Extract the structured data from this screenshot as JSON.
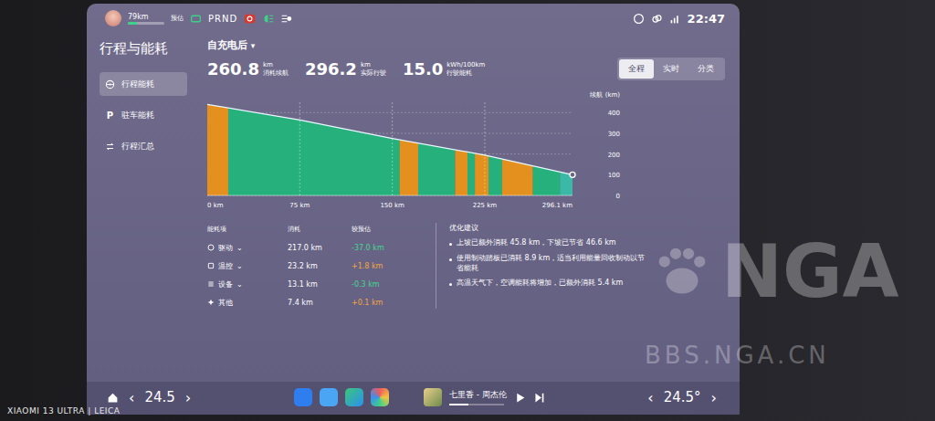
{
  "status_bar": {
    "range": "79km",
    "range_level": 0.25,
    "estimate": "预估",
    "gear": "PRND",
    "time": "22:47"
  },
  "sidebar": {
    "title": "行程与能耗",
    "items": [
      {
        "label": "行程能耗",
        "selected": true,
        "kind": "wheel"
      },
      {
        "label": "驻车能耗",
        "selected": false,
        "kind": "letter",
        "glyph": "P"
      },
      {
        "label": "行程汇总",
        "selected": false,
        "kind": "route"
      }
    ]
  },
  "filter": {
    "label": "自充电后",
    "arrow": "▾"
  },
  "stats": [
    {
      "value": "260.8",
      "unit": "km",
      "label": "消耗续航"
    },
    {
      "value": "296.2",
      "unit": "km",
      "label": "实际行驶"
    },
    {
      "value": "15.0",
      "unit": "kWh/100km",
      "label": "行驶能耗"
    }
  ],
  "modes": [
    {
      "label": "全程",
      "selected": true
    },
    {
      "label": "实时",
      "selected": false
    },
    {
      "label": "分类",
      "selected": false
    }
  ],
  "chart": {
    "y_axis_title": "续航 (km)",
    "y_ticks": [
      "400",
      "300",
      "200",
      "100",
      "0"
    ],
    "x_ticks": [
      "0 km",
      "75 km",
      "150 km",
      "225 km",
      "296.1 km"
    ],
    "series": {
      "km": [
        0,
        75,
        150,
        225,
        296.1
      ],
      "range": [
        440,
        365,
        275,
        195,
        100
      ]
    },
    "segments": [
      {
        "start": 0,
        "end": 17,
        "color": "#e3901e"
      },
      {
        "start": 17,
        "end": 156,
        "color": "#25b07c"
      },
      {
        "start": 156,
        "end": 171,
        "color": "#e3901e"
      },
      {
        "start": 171,
        "end": 201,
        "color": "#25b07c"
      },
      {
        "start": 201,
        "end": 211,
        "color": "#e3901e"
      },
      {
        "start": 211,
        "end": 217,
        "color": "#25b07c"
      },
      {
        "start": 217,
        "end": 228,
        "color": "#e3901e"
      },
      {
        "start": 228,
        "end": 239,
        "color": "#25b07c"
      },
      {
        "start": 239,
        "end": 264,
        "color": "#e3901e"
      },
      {
        "start": 264,
        "end": 286,
        "color": "#25b07c"
      },
      {
        "start": 286,
        "end": 296.1,
        "color": "#3bb8a6"
      }
    ]
  },
  "table": {
    "columns": [
      "能耗项",
      "消耗",
      "较预估"
    ],
    "rows": [
      {
        "name": "驱动",
        "kind": "drive",
        "value": "217.0 km",
        "delta": "-37.0 km",
        "trend": "saving",
        "expand": "⌄"
      },
      {
        "name": "温控",
        "kind": "climate",
        "value": "23.2 km",
        "delta": "+1.8 km",
        "trend": "extra",
        "expand": "⌄"
      },
      {
        "name": "设备",
        "kind": "device",
        "value": "13.1 km",
        "delta": "-0.3 km",
        "trend": "saving",
        "expand": "⌄"
      },
      {
        "name": "其他",
        "kind": "other",
        "value": "7.4 km",
        "delta": "+0.1 km",
        "trend": "extra",
        "expand": ""
      }
    ]
  },
  "suggestions": {
    "title": "优化建议",
    "items": [
      "上坡已额外消耗 45.8 km，下坡已节省 46.6 km",
      "使用制动踏板已消耗 8.9 km，适当利用能量回收制动以节省能耗",
      "高温天气下，空调能耗将增加，已额外消耗 5.4 km"
    ]
  },
  "dock": {
    "left_temp": "24.5",
    "right_temp": "24.5°",
    "prev": "‹",
    "next": "›",
    "song": "七里香 - 周杰伦",
    "song_progress": 0.35
  },
  "photo": {
    "camera_watermark": "XIAOMI 13 ULTRA | LEICA",
    "site_logo": "NGA",
    "site_url": "BBS.NGA.CN"
  }
}
